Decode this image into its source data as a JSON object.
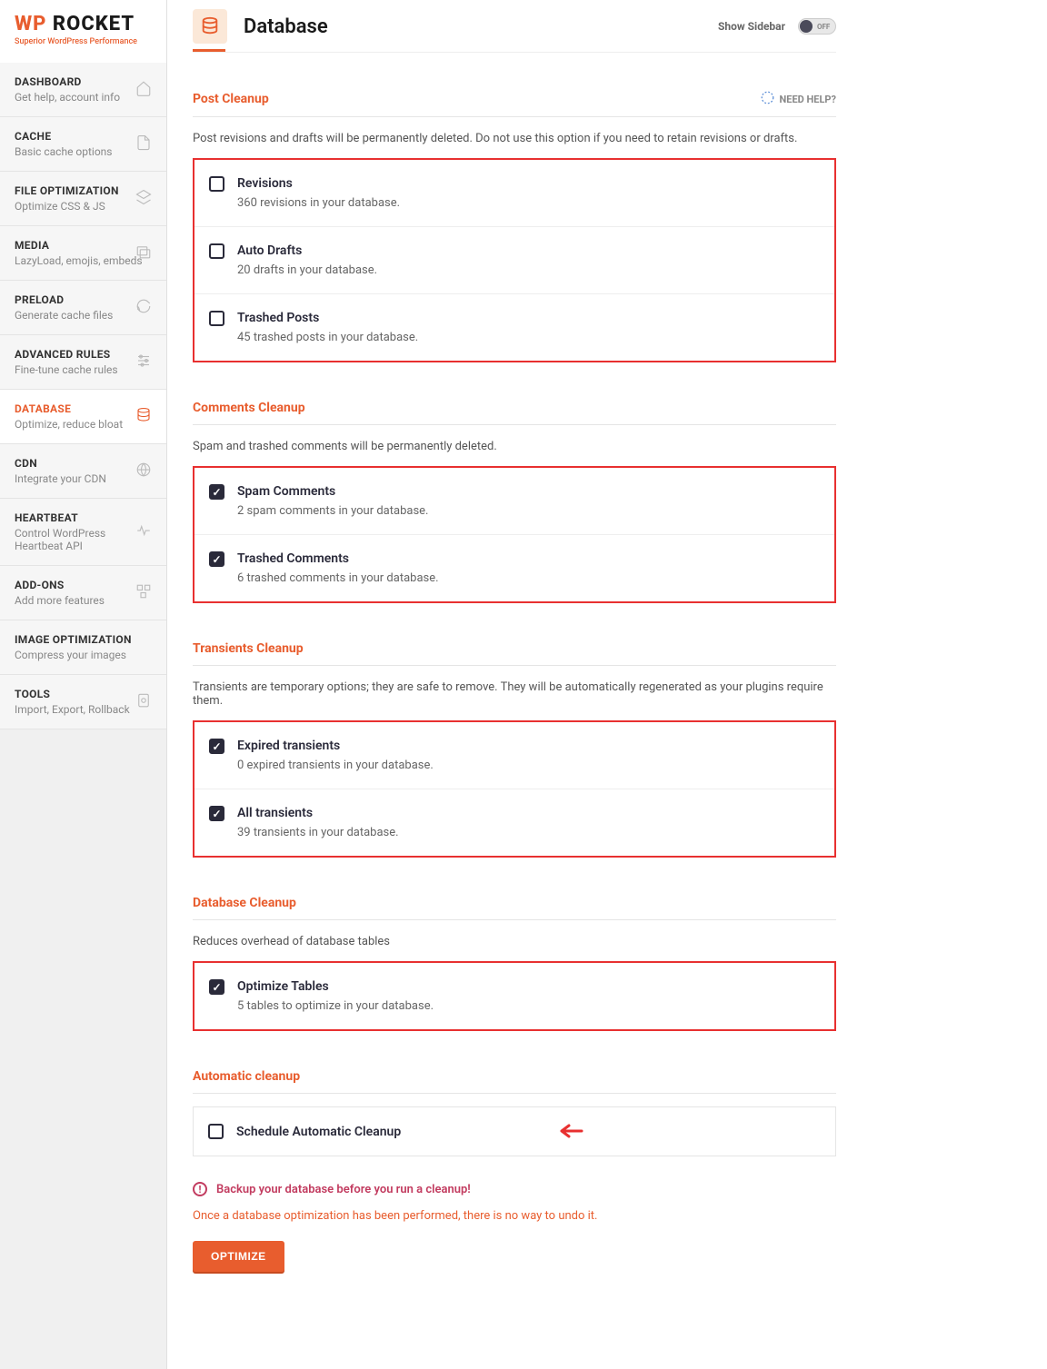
{
  "brand": {
    "wp": "WP",
    "rocket": " ROCKET",
    "tagline": "Superior WordPress Performance"
  },
  "nav": [
    {
      "title": "DASHBOARD",
      "sub": "Get help, account info",
      "icon": "home"
    },
    {
      "title": "CACHE",
      "sub": "Basic cache options",
      "icon": "file"
    },
    {
      "title": "FILE OPTIMIZATION",
      "sub": "Optimize CSS & JS",
      "icon": "layers"
    },
    {
      "title": "MEDIA",
      "sub": "LazyLoad, emojis, embeds",
      "icon": "images"
    },
    {
      "title": "PRELOAD",
      "sub": "Generate cache files",
      "icon": "refresh"
    },
    {
      "title": "ADVANCED RULES",
      "sub": "Fine-tune cache rules",
      "icon": "sliders"
    },
    {
      "title": "DATABASE",
      "sub": "Optimize, reduce bloat",
      "icon": "database",
      "active": true
    },
    {
      "title": "CDN",
      "sub": "Integrate your CDN",
      "icon": "globe"
    },
    {
      "title": "HEARTBEAT",
      "sub": "Control WordPress Heartbeat API",
      "icon": "heartbeat"
    },
    {
      "title": "ADD-ONS",
      "sub": "Add more features",
      "icon": "addons"
    },
    {
      "title": "IMAGE OPTIMIZATION",
      "sub": "Compress your images",
      "icon": ""
    },
    {
      "title": "TOOLS",
      "sub": "Import, Export, Rollback",
      "icon": "tool"
    }
  ],
  "header": {
    "title": "Database",
    "show_sidebar": "Show Sidebar",
    "toggle": "OFF"
  },
  "help": "NEED HELP?",
  "sections": {
    "post_cleanup": {
      "title": "Post Cleanup",
      "desc": "Post revisions and drafts will be permanently deleted. Do not use this option if you need to retain revisions or drafts.",
      "items": [
        {
          "title": "Revisions",
          "sub": "360 revisions in your database.",
          "checked": false
        },
        {
          "title": "Auto Drafts",
          "sub": "20 drafts in your database.",
          "checked": false
        },
        {
          "title": "Trashed Posts",
          "sub": "45 trashed posts in your database.",
          "checked": false
        }
      ]
    },
    "comments_cleanup": {
      "title": "Comments Cleanup",
      "desc": "Spam and trashed comments will be permanently deleted.",
      "items": [
        {
          "title": "Spam Comments",
          "sub": "2 spam comments in your database.",
          "checked": true
        },
        {
          "title": "Trashed Comments",
          "sub": "6 trashed comments in your database.",
          "checked": true
        }
      ]
    },
    "transients_cleanup": {
      "title": "Transients Cleanup",
      "desc": "Transients are temporary options; they are safe to remove. They will be automatically regenerated as your plugins require them.",
      "items": [
        {
          "title": "Expired transients",
          "sub": "0 expired transients in your database.",
          "checked": true
        },
        {
          "title": "All transients",
          "sub": "39 transients in your database.",
          "checked": true
        }
      ]
    },
    "database_cleanup": {
      "title": "Database Cleanup",
      "desc": "Reduces overhead of database tables",
      "items": [
        {
          "title": "Optimize Tables",
          "sub": "5 tables to optimize in your database.",
          "checked": true
        }
      ]
    },
    "automatic_cleanup": {
      "title": "Automatic cleanup",
      "item": {
        "title": "Schedule Automatic Cleanup",
        "checked": false
      }
    }
  },
  "warning": "Backup your database before you run a cleanup!",
  "note": "Once a database optimization has been performed, there is no way to undo it.",
  "optimize_btn": "OPTIMIZE"
}
